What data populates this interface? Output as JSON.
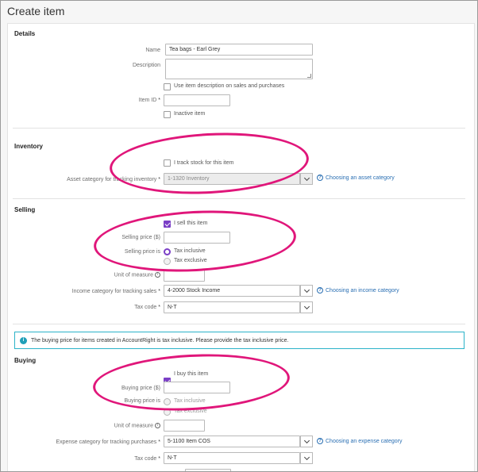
{
  "page": {
    "title": "Create item"
  },
  "details": {
    "heading": "Details",
    "name_label": "Name",
    "name_value": "Tea bags - Earl Grey",
    "description_label": "Description",
    "description_value": "",
    "use_desc_label": "Use item description on sales and purchases",
    "item_id_label": "Item ID",
    "item_id_value": "",
    "inactive_label": "Inactive item",
    "required_mark": "*"
  },
  "inventory": {
    "heading": "Inventory",
    "track_stock_label": "I track stock for this item",
    "asset_category_label": "Asset category for tracking inventory",
    "asset_category_value": "1-1320  Inventory",
    "help_link": "Choosing an asset category"
  },
  "selling": {
    "heading": "Selling",
    "sell_label": "I sell this item",
    "selling_price_label": "Selling price ($)",
    "selling_price_value": "",
    "selling_price_is_label": "Selling price is",
    "tax_inclusive": "Tax inclusive",
    "tax_exclusive": "Tax exclusive",
    "unit_label": "Unit of measure",
    "unit_value": "",
    "income_category_label": "Income category for tracking sales",
    "income_category_value": "4-2000  Stock Income",
    "income_help_link": "Choosing an income category",
    "tax_code_label": "Tax code",
    "tax_code_value": "N-T"
  },
  "notice": {
    "text": "The buying price for items created in AccountRight is tax inclusive. Please provide the tax inclusive price."
  },
  "buying": {
    "heading": "Buying",
    "buy_label": "I buy this item",
    "buying_price_label": "Buying price ($)",
    "buying_price_value": "",
    "buying_price_is_label": "Buying price is",
    "tax_inclusive": "Tax inclusive",
    "tax_exclusive": "Tax exclusive",
    "unit_label": "Unit of measure",
    "unit_value": "",
    "expense_category_label": "Expense category for tracking purchases",
    "expense_category_value": "5-1100  Item COS",
    "expense_help_link": "Choosing an expense category",
    "tax_code_label": "Tax code",
    "tax_code_value": "N-T"
  },
  "colors": {
    "accent_purple": "#7b3fc6",
    "link_blue": "#2a6fb3",
    "annotation_pink": "#e0167a",
    "notice_teal": "#2bb3c9"
  },
  "icons": {
    "help": "question-circle-icon",
    "info": "info-circle-icon",
    "dropdown": "chevron-down-icon"
  }
}
